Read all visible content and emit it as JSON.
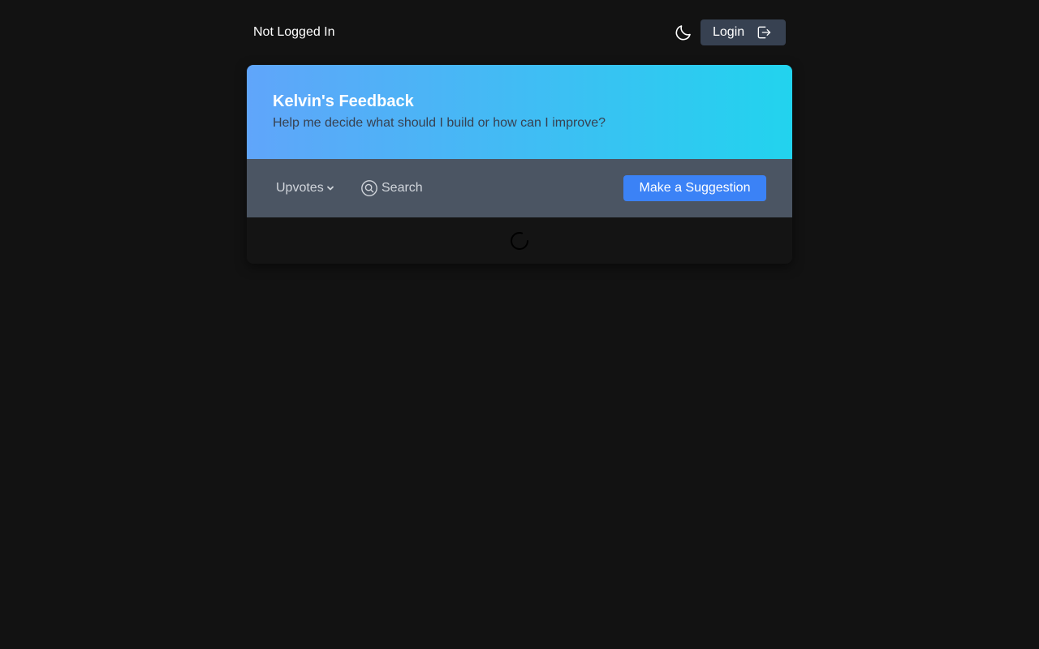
{
  "header": {
    "status_text": "Not Logged In",
    "theme_icon": "moon-icon",
    "login_label": "Login",
    "login_icon": "logout-arrow-icon"
  },
  "hero": {
    "title": "Kelvin's Feedback",
    "subtitle": "Help me decide what should I build or how can I improve?",
    "gradient_from": "#60a5fa",
    "gradient_to": "#22d3ee"
  },
  "toolbar": {
    "sort_label": "Upvotes",
    "sort_icon": "chevron-down-icon",
    "search_icon": "search-icon",
    "search_placeholder": "Search",
    "suggest_label": "Make a Suggestion",
    "accent": "#3b82f6"
  },
  "list": {
    "loading_icon": "spinner-icon"
  }
}
